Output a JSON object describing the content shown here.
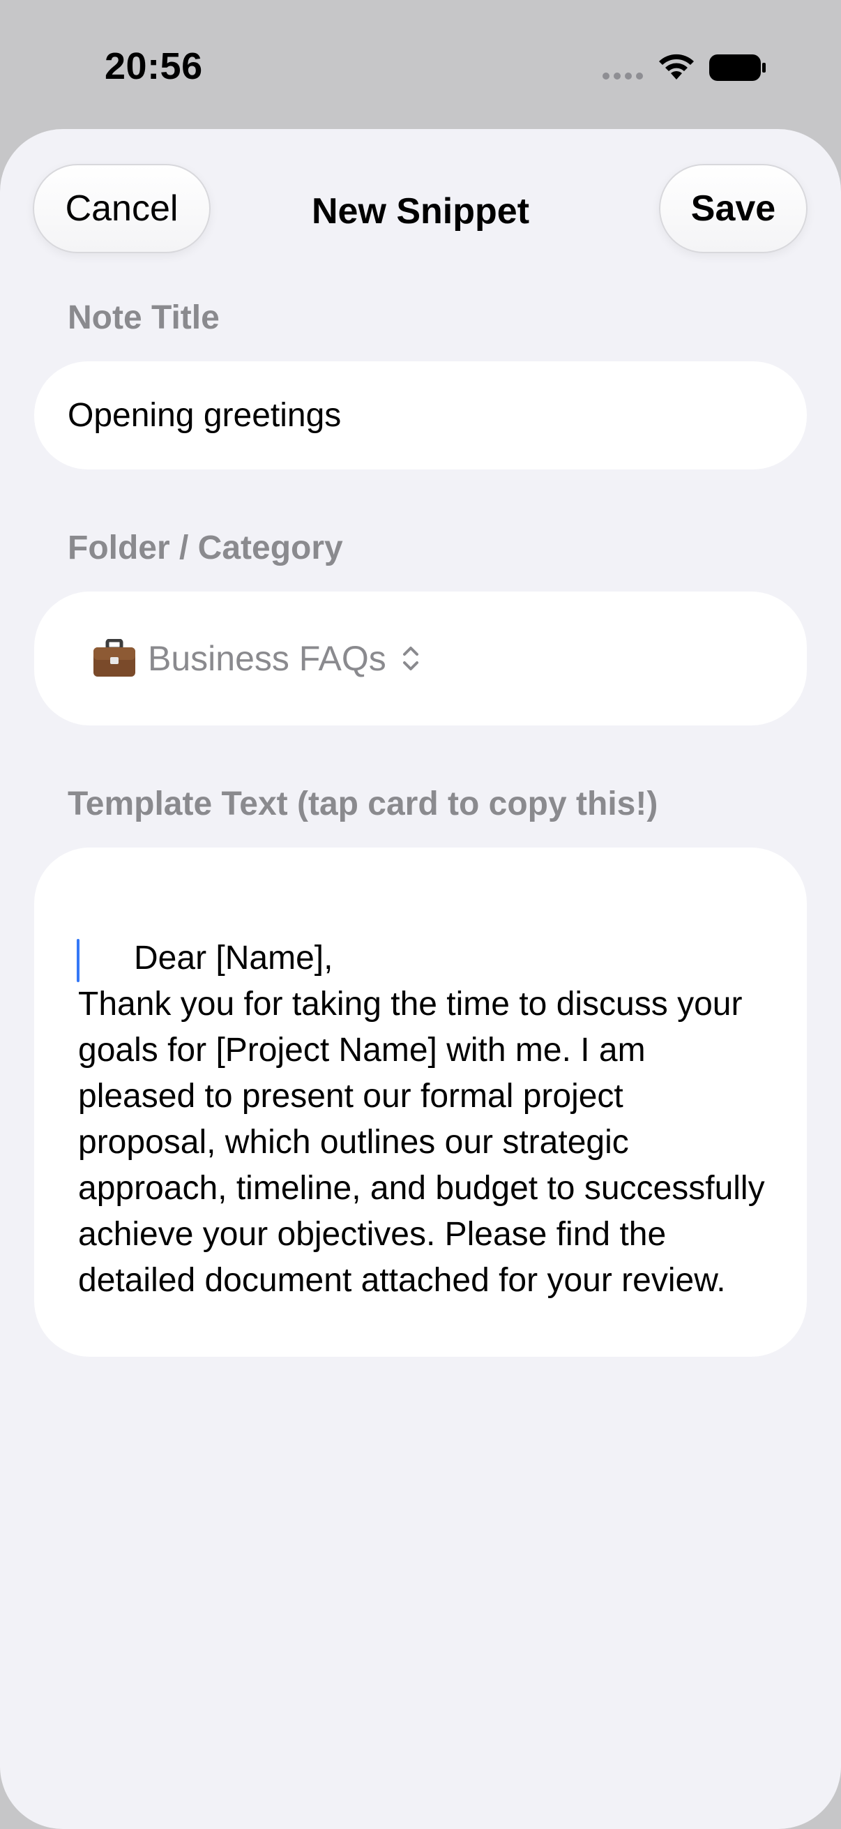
{
  "status_bar": {
    "time": "20:56",
    "icons": [
      "signal-dots-icon",
      "wifi-icon",
      "battery-icon"
    ]
  },
  "sheet": {
    "title": "New Snippet",
    "cancel_label": "Cancel",
    "save_label": "Save"
  },
  "form": {
    "note_title_label": "Note Title",
    "note_title_value": "Opening greetings",
    "folder_label": "Folder / Category",
    "folder_value": "Business FAQs",
    "folder_icon": "briefcase-icon",
    "template_label": "Template Text (tap card to copy this!)",
    "template_value": "Dear [Name],\nThank you for taking the time to discuss your goals for [Project Name] with me. I am pleased to present our formal project proposal, which outlines our strategic approach, timeline, and budget to successfully achieve your objectives. Please find the detailed document attached for your review."
  },
  "colors": {
    "sheet_background": "#f2f2f7",
    "field_background": "#ffffff",
    "label_gray": "#8a8a8e",
    "cursor_blue": "#3478f6"
  }
}
